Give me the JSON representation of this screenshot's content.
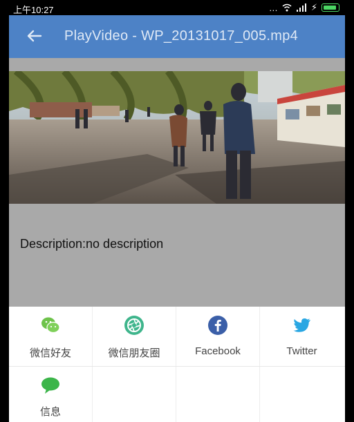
{
  "status_bar": {
    "time": "上午10:27"
  },
  "app_bar": {
    "title": "PlayVideo - WP_20131017_005.mp4"
  },
  "description": "Description:no description",
  "share": {
    "items": [
      {
        "label": "微信好友",
        "icon": "wechat-icon",
        "color": "#6ec34b"
      },
      {
        "label": "微信朋友圈",
        "icon": "wechat-moments-icon",
        "color": "#3fb58c"
      },
      {
        "label": "Facebook",
        "icon": "facebook-icon",
        "color": "#3b5fa8"
      },
      {
        "label": "Twitter",
        "icon": "twitter-icon",
        "color": "#2aa7e3"
      },
      {
        "label": "信息",
        "icon": "message-icon",
        "color": "#3cb54a"
      }
    ]
  },
  "colors": {
    "app_bar": "#4d82c6",
    "content_bg": "#a9a9a9"
  }
}
